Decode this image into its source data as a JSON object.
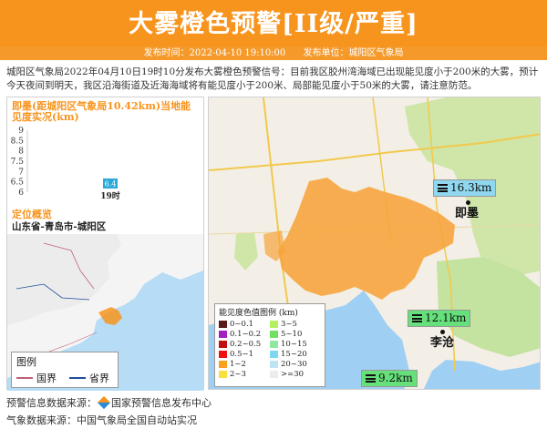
{
  "header": {
    "title": "大雾橙色预警[II级/严重]",
    "publish_time": "发布时间：2022-04-10 19:10:00",
    "publisher": "发布单位：城阳区气象局"
  },
  "description": "城阳区气象局2022年04月10日19时10分发布大雾橙色预警信号：目前我区胶州湾海域已出现能见度小于200米的大雾，预计今天夜间到明天，我区沿海街道及近海海域将有能见度小于200米、局部能见度小于50米的大雾，请注意防范。",
  "chart_data": {
    "type": "bar",
    "title": "即墨(距城阳区气象局10.42km)当地能见度实况(km)",
    "categories": [
      "19时"
    ],
    "values": [
      6.4
    ],
    "ylim": [
      6,
      9
    ],
    "yticks": [
      "9",
      "8.5",
      "8",
      "7.5",
      "7",
      "6.5",
      "6"
    ],
    "bar_color": "#2aa9d9"
  },
  "location": {
    "section_title": "定位概览",
    "region": "山东省-青岛市-城阳区"
  },
  "mini_legend": {
    "title": "图例",
    "items": [
      {
        "label": "国界",
        "color": "#c0607a"
      },
      {
        "label": "省界",
        "color": "#1f4e9c"
      }
    ]
  },
  "stations": [
    {
      "value": "16.3km",
      "color": "#8fd8ef"
    },
    {
      "value": "12.1km",
      "color": "#66e07a"
    },
    {
      "value": "9.2km",
      "color": "#66e07a"
    }
  ],
  "places": [
    "即墨",
    "李沧"
  ],
  "vis_legend": {
    "title": "能见度色值图例 (km)",
    "items": [
      {
        "label": "0~0.1",
        "color": "#5a1a1a"
      },
      {
        "label": "3~5",
        "color": "#b4f060"
      },
      {
        "label": "0.1~0.2",
        "color": "#a020c0"
      },
      {
        "label": "5~10",
        "color": "#70e060"
      },
      {
        "label": "0.2~0.5",
        "color": "#c01010"
      },
      {
        "label": "10~15",
        "color": "#90e8a0"
      },
      {
        "label": "0.5~1",
        "color": "#f01010"
      },
      {
        "label": "15~20",
        "color": "#80d8f0"
      },
      {
        "label": "1~2",
        "color": "#f8a020"
      },
      {
        "label": "20~30",
        "color": "#c0e4f4"
      },
      {
        "label": "2~3",
        "color": "#f8e040"
      },
      {
        "label": ">=30",
        "color": "#ececec"
      }
    ]
  },
  "footer": {
    "warning_source_label": "预警信息数据来源：",
    "warning_source": "国家预警信息发布中心",
    "weather_source": "气象数据来源：中国气象局全国自动站实况"
  }
}
